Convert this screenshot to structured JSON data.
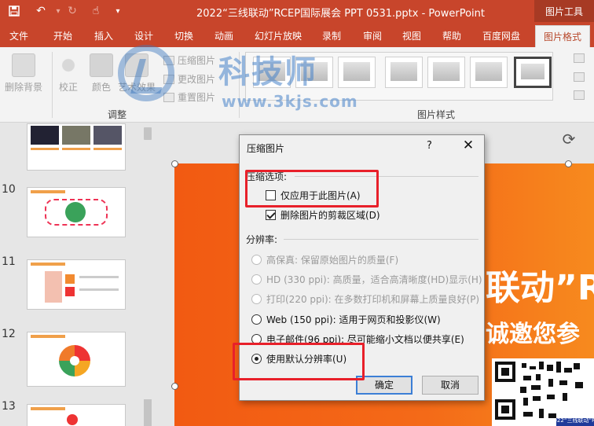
{
  "titlebar": {
    "doc_title": "2022“三线联动”RCEP国际展会 PPT 0531.pptx  -  PowerPoint",
    "context_tab": "图片工具",
    "quick_access": [
      "save-icon",
      "undo-icon",
      "redo-icon",
      "touch-mode-icon",
      "customize-icon"
    ]
  },
  "tabs": [
    "文件",
    "开始",
    "插入",
    "设计",
    "切换",
    "动画",
    "幻灯片放映",
    "录制",
    "审阅",
    "视图",
    "帮助",
    "百度网盘",
    "图片格式"
  ],
  "ribbon": {
    "remove_bg": "删除背景",
    "corrections": "校正",
    "color": "颜色",
    "artistic": "艺术效果",
    "compress": "压缩图片",
    "change": "更改图片",
    "reset": "重置图片",
    "adjust_group": "调整",
    "styles_group": "图片样式"
  },
  "watermark": {
    "text": "科技师",
    "url": "www.3kjs.com"
  },
  "slides": [
    {
      "num": "10"
    },
    {
      "num": "11"
    },
    {
      "num": "12"
    },
    {
      "num": "13"
    }
  ],
  "slide": {
    "big_text": "联动”R",
    "sub_text": "诚邀您参",
    "qr_caption": "2022“三线联动”RCE"
  },
  "dialog": {
    "title": "压缩图片",
    "help": "?",
    "compress_options_label": "压缩选项:",
    "only_this": "仅应用于此图片(A)",
    "only_this_checked": false,
    "delete_cropped": "删除图片的剪裁区域(D)",
    "delete_cropped_checked": true,
    "resolution_label": "分辨率:",
    "resolutions": [
      {
        "label": "高保真: 保留原始图片的质量(F)",
        "enabled": false,
        "selected": false
      },
      {
        "label": "HD (330 ppi): 高质量，适合高清晰度(HD)显示(H)",
        "enabled": false,
        "selected": false
      },
      {
        "label": "打印(220 ppi): 在多数打印机和屏幕上质量良好(P)",
        "enabled": false,
        "selected": false
      },
      {
        "label": "Web (150 ppi): 适用于网页和投影仪(W)",
        "enabled": true,
        "selected": false
      },
      {
        "label": "电子邮件(96 ppi): 尽可能缩小文档以便共享(E)",
        "enabled": true,
        "selected": false
      },
      {
        "label": "使用默认分辨率(U)",
        "enabled": true,
        "selected": true
      }
    ],
    "ok": "确定",
    "cancel": "取消"
  },
  "colors": {
    "title_bar": "#c8452b",
    "annotation": "#e8202a",
    "slide_orange": "#f25a12"
  }
}
